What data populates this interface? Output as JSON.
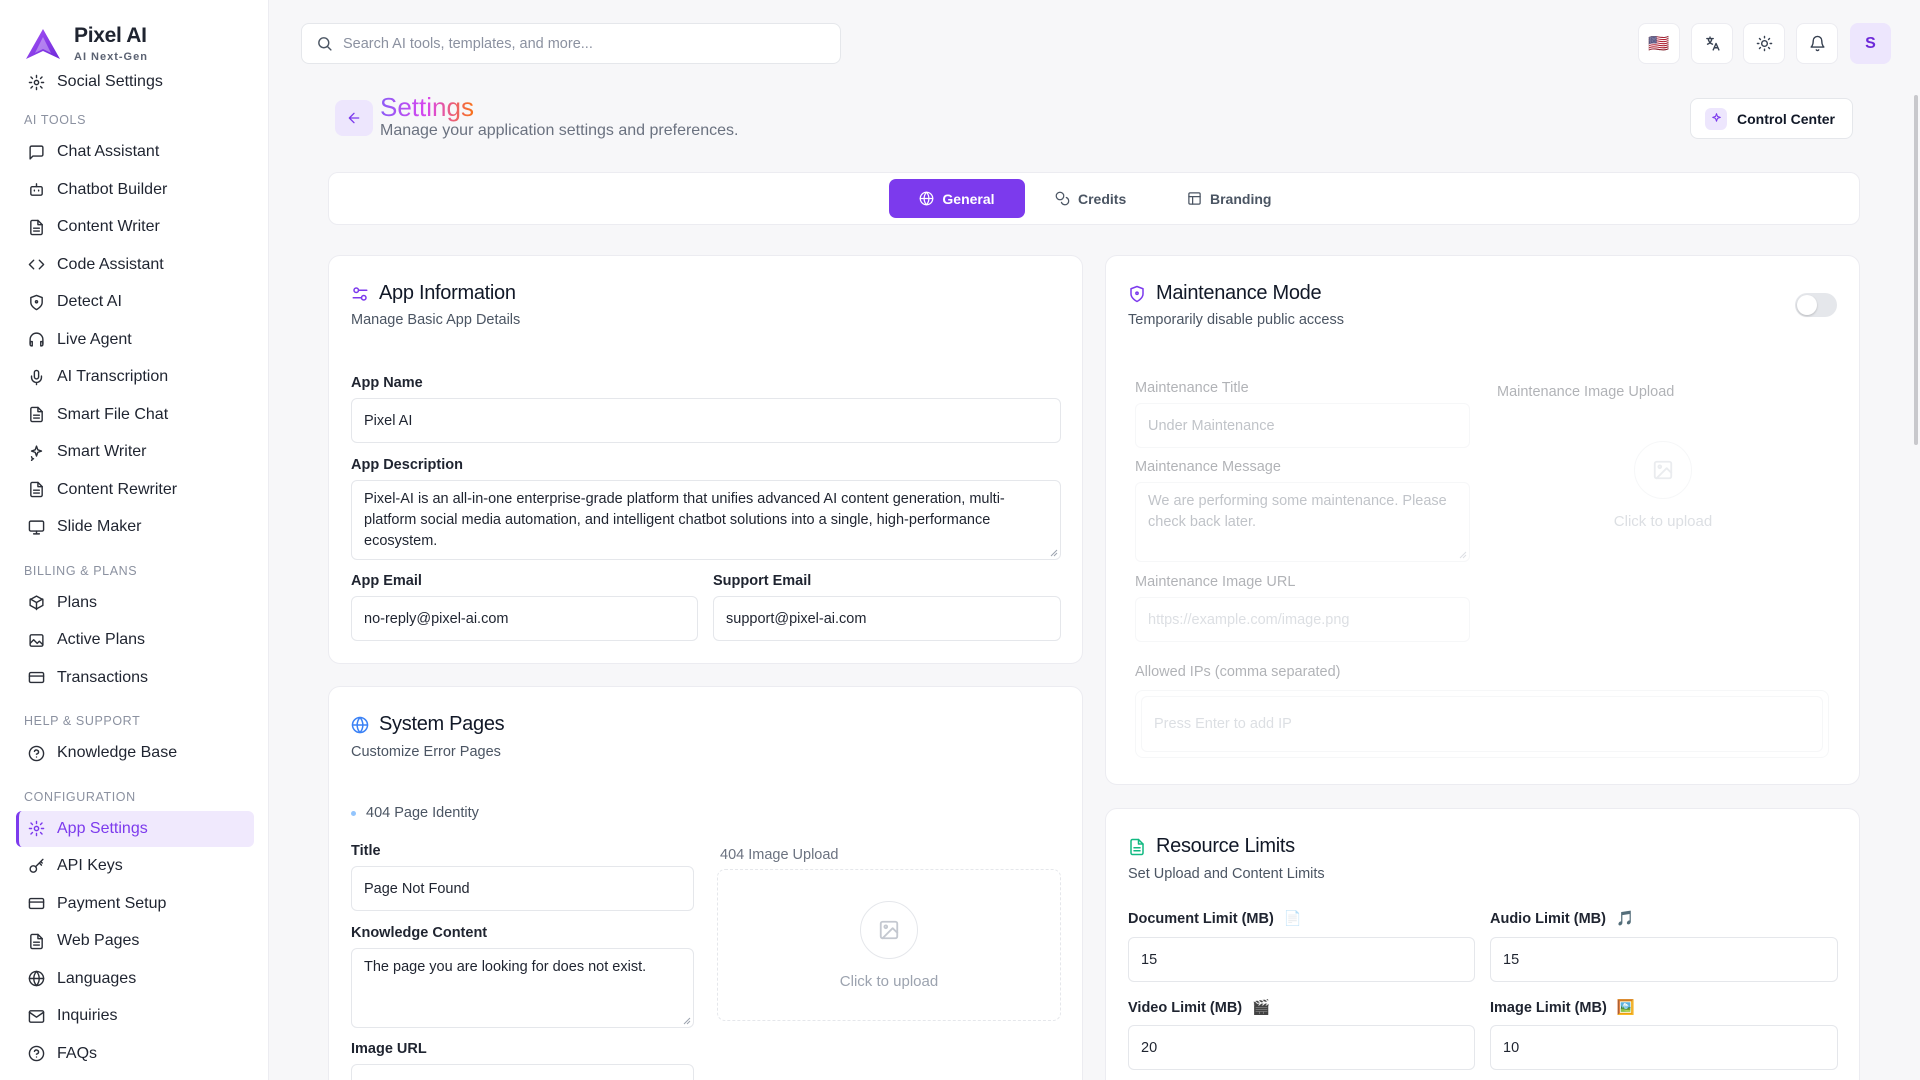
{
  "brand": {
    "name": "Pixel AI",
    "tagline": "AI Next-Gen"
  },
  "sidebar": {
    "top_item": "Social Settings",
    "sections": [
      {
        "title": "AI TOOLS",
        "items": [
          {
            "label": "Chat Assistant",
            "icon": "message-square-icon"
          },
          {
            "label": "Chatbot Builder",
            "icon": "bot-icon"
          },
          {
            "label": "Content Writer",
            "icon": "file-text-icon"
          },
          {
            "label": "Code Assistant",
            "icon": "code-icon"
          },
          {
            "label": "Detect AI",
            "icon": "shield-icon"
          },
          {
            "label": "Live Agent",
            "icon": "headphones-icon"
          },
          {
            "label": "AI Transcription",
            "icon": "mic-icon"
          },
          {
            "label": "Smart File Chat",
            "icon": "file-text-icon"
          },
          {
            "label": "Smart Writer",
            "icon": "sparkles-icon"
          },
          {
            "label": "Content Rewriter",
            "icon": "file-text-icon"
          },
          {
            "label": "Slide Maker",
            "icon": "presentation-icon"
          }
        ]
      },
      {
        "title": "BILLING & PLANS",
        "items": [
          {
            "label": "Plans",
            "icon": "package-icon"
          },
          {
            "label": "Active Plans",
            "icon": "image-icon"
          },
          {
            "label": "Transactions",
            "icon": "credit-card-icon"
          }
        ]
      },
      {
        "title": "HELP & SUPPORT",
        "items": [
          {
            "label": "Knowledge Base",
            "icon": "help-circle-icon"
          }
        ]
      },
      {
        "title": "CONFIGURATION",
        "items": [
          {
            "label": "App Settings",
            "icon": "gear-icon",
            "active": true
          },
          {
            "label": "API Keys",
            "icon": "key-icon"
          },
          {
            "label": "Payment Setup",
            "icon": "credit-card-icon"
          },
          {
            "label": "Web Pages",
            "icon": "file-text-icon"
          },
          {
            "label": "Languages",
            "icon": "globe-icon"
          },
          {
            "label": "Inquiries",
            "icon": "mail-icon"
          },
          {
            "label": "FAQs",
            "icon": "help-circle-icon"
          }
        ]
      }
    ]
  },
  "topbar": {
    "search_placeholder": "Search AI tools, templates, and more...",
    "avatar_initial": "S",
    "flag": "🇺🇸"
  },
  "header": {
    "title": "Settings",
    "subtitle": "Manage your application settings and preferences.",
    "control_center": "Control Center"
  },
  "tabs": [
    "General",
    "Credits",
    "Branding"
  ],
  "app_info": {
    "title": "App Information",
    "subtitle": "Manage Basic App Details",
    "app_name_label": "App Name",
    "app_name": "Pixel AI",
    "desc_label": "App Description",
    "desc": "Pixel-AI is an all-in-one enterprise-grade platform that unifies advanced AI content generation, multi-platform social media automation, and intelligent chatbot solutions into a single, high-performance ecosystem.",
    "app_email_label": "App Email",
    "app_email": "no-reply@pixel-ai.com",
    "support_email_label": "Support Email",
    "support_email": "support@pixel-ai.com"
  },
  "system_pages": {
    "title": "System Pages",
    "subtitle": "Customize Error Pages",
    "identity": "404 Page Identity",
    "title_label": "Title",
    "title_value": "Page Not Found",
    "content_label": "Knowledge Content",
    "content_value": "The page you are looking for does not exist.",
    "image_url_label": "Image URL",
    "upload_label": "404 Image Upload",
    "upload_text": "Click to upload"
  },
  "maintenance": {
    "title": "Maintenance Mode",
    "subtitle": "Temporarily disable public access",
    "enabled": false,
    "title_label": "Maintenance Title",
    "title_value": "Under Maintenance",
    "message_label": "Maintenance Message",
    "message_value": "We are performing some maintenance. Please check back later.",
    "image_url_label": "Maintenance Image URL",
    "image_url_placeholder": "https://example.com/image.png",
    "ips_label": "Allowed IPs (comma separated)",
    "ips_placeholder": "Press Enter to add IP",
    "upload_label": "Maintenance Image Upload",
    "upload_text": "Click to upload"
  },
  "limits": {
    "title": "Resource Limits",
    "subtitle": "Set Upload and Content Limits",
    "document_label": "Document Limit (MB)",
    "document_emoji": "📄",
    "document": "15",
    "audio_label": "Audio Limit (MB)",
    "audio_emoji": "🎵",
    "audio": "15",
    "video_label": "Video Limit (MB)",
    "video_emoji": "🎬",
    "video": "20",
    "image_label": "Image Limit (MB)",
    "image_emoji": "🖼️",
    "image": "10"
  },
  "colors": {
    "accent": "#7c3aed",
    "accent_soft": "#ede6fd"
  }
}
